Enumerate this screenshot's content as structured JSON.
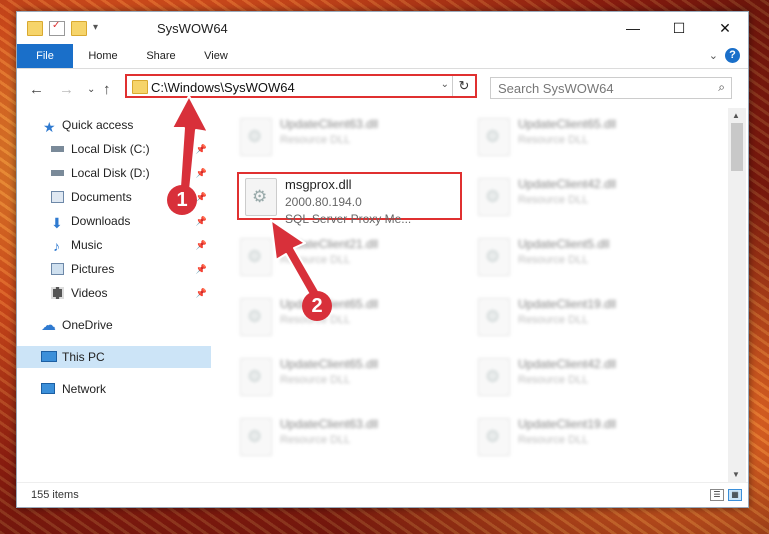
{
  "window": {
    "title": "SysWOW64",
    "controls": {
      "minimize": "—",
      "maximize": "☐",
      "close": "✕"
    }
  },
  "ribbon": {
    "tabs": [
      "File",
      "Home",
      "Share",
      "View"
    ],
    "expand": "⌄",
    "help": "?"
  },
  "nav": {
    "back": "←",
    "forward": "→",
    "recent": "⌄",
    "up": "↑",
    "address": "C:\\Windows\\SysWOW64",
    "address_dropdown": "⌄",
    "refresh": "↻",
    "search_placeholder": "Search SysWOW64",
    "search_icon": "⌕"
  },
  "sidebar": {
    "pin_glyph": "📌",
    "items": [
      {
        "label": "Quick access",
        "icon": "star-icon",
        "color": "#2f7ad0"
      },
      {
        "label": "Local Disk (C:)",
        "icon": "drive-icon",
        "color": "#7a8a99"
      },
      {
        "label": "Local Disk (D:)",
        "icon": "drive-icon",
        "color": "#7a8a99"
      },
      {
        "label": "Documents",
        "icon": "documents-icon",
        "color": "#6d88a8"
      },
      {
        "label": "Downloads",
        "icon": "download-icon",
        "color": "#2f7ad0"
      },
      {
        "label": "Music",
        "icon": "music-icon",
        "color": "#2f7ad0"
      },
      {
        "label": "Pictures",
        "icon": "pictures-icon",
        "color": "#6d88a8"
      },
      {
        "label": "Videos",
        "icon": "videos-icon",
        "color": "#444"
      },
      {
        "label": "OneDrive",
        "icon": "cloud-icon",
        "color": "#2f7ad0"
      },
      {
        "label": "This PC",
        "icon": "computer-icon",
        "color": "#2f7ad0"
      },
      {
        "label": "Network",
        "icon": "network-icon",
        "color": "#2f7ad0"
      }
    ]
  },
  "files": {
    "focus": {
      "name": "msgprox.dll",
      "version": "2000.80.194.0",
      "description": "SQL Server Proxy Me..."
    },
    "blurred": [
      {
        "name": "UpdateClient63.dll",
        "type": "Resource DLL"
      },
      {
        "name": "UpdateClient65.dll",
        "type": "Resource DLL"
      },
      {
        "name": "UpdateClient42.dll",
        "type": "Resource DLL"
      },
      {
        "name": "UpdateClient21.dll",
        "type": "Resource DLL"
      },
      {
        "name": "UpdateClient5.dll",
        "type": "Resource DLL"
      },
      {
        "name": "UpdateClient65.dll",
        "type": "Resource DLL"
      },
      {
        "name": "UpdateClient19.dll",
        "type": "Resource DLL"
      },
      {
        "name": "UpdateClient65.dll",
        "type": "Resource DLL"
      },
      {
        "name": "UpdateClient42.dll",
        "type": "Resource DLL"
      },
      {
        "name": "UpdateClient63.dll",
        "type": "Resource DLL"
      },
      {
        "name": "UpdateClient19.dll",
        "type": "Resource DLL"
      }
    ]
  },
  "status": {
    "count": "155 items",
    "details_view": "☰",
    "tiles_view": "▦"
  },
  "annotations": {
    "step1": "1",
    "step2": "2",
    "color": "#d8303a"
  }
}
